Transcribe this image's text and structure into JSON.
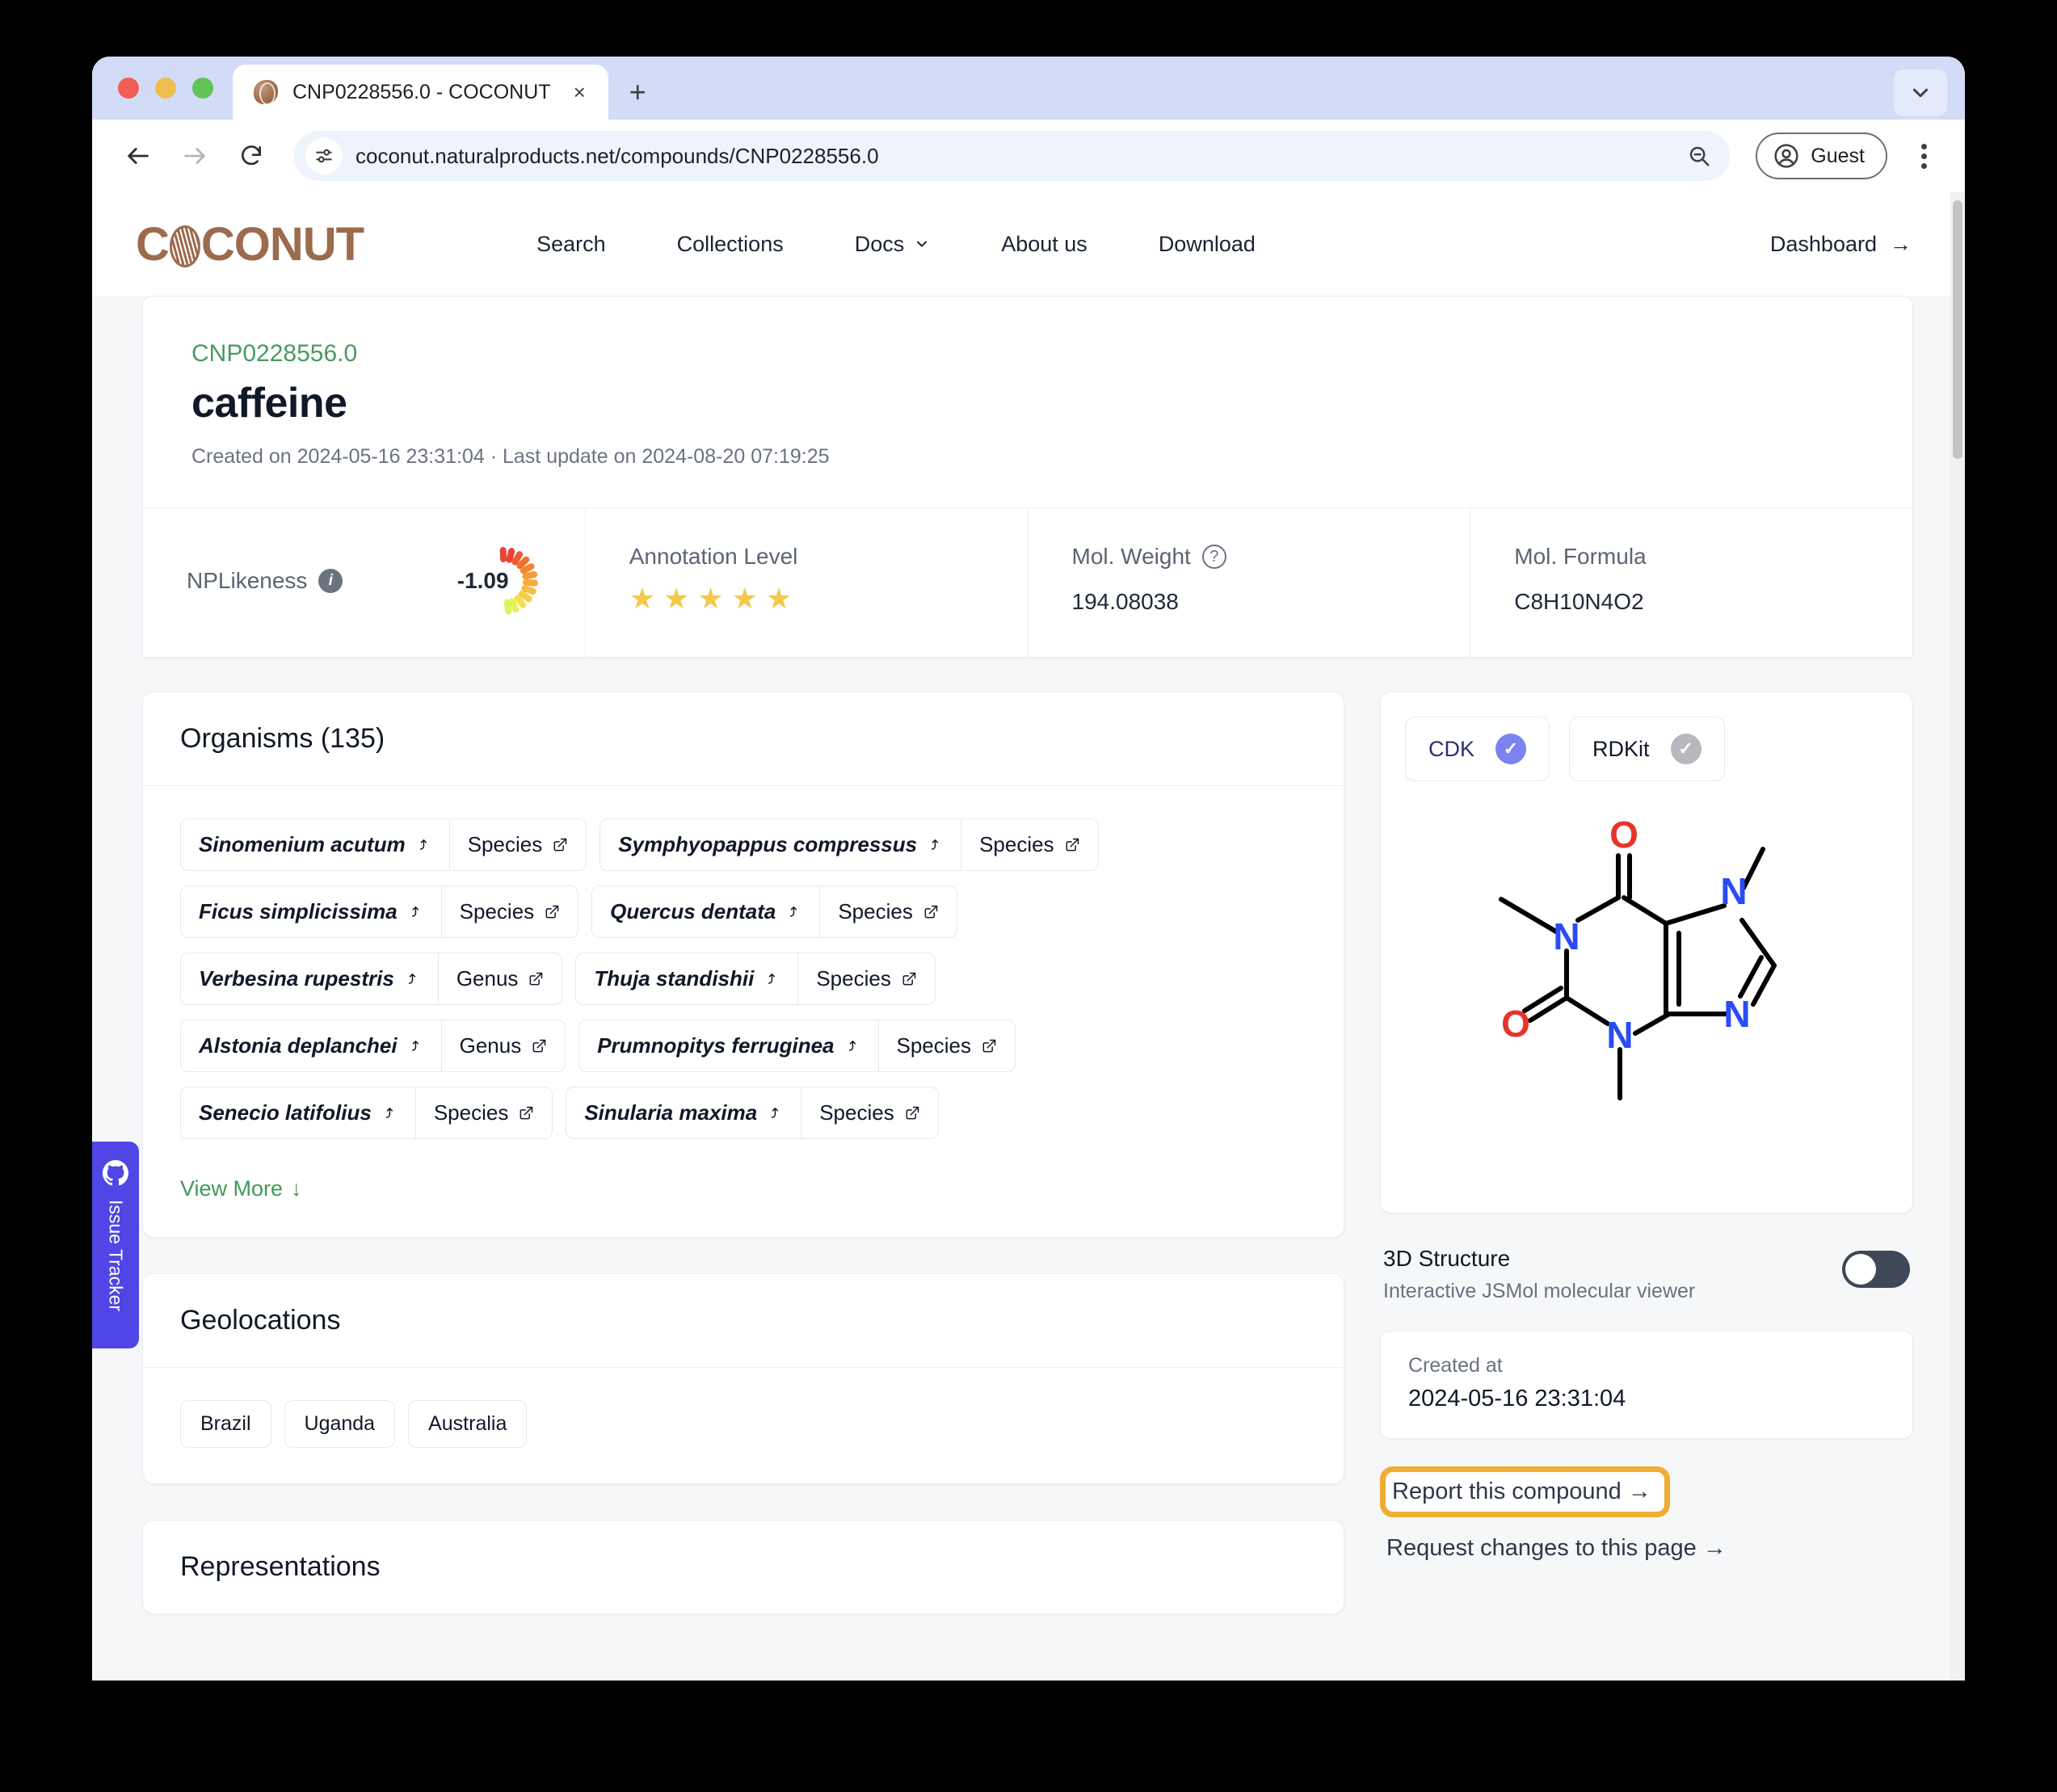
{
  "browser": {
    "tab": {
      "title": "CNP0228556.0 - COCONUT",
      "close_label": "×",
      "favicon": "coconut-favicon"
    },
    "new_tab_label": "+",
    "url": "coconut.naturalproducts.net/compounds/CNP0228556.0",
    "profile_label": "Guest",
    "back_icon": "back-arrow-icon",
    "forward_icon": "forward-arrow-icon",
    "reload_icon": "reload-icon",
    "site_info_icon": "site-settings-icon",
    "zoom_icon": "zoom-out-icon",
    "menu_icon": "kebab-menu-icon",
    "tab_list_icon": "chevron-down-icon"
  },
  "site": {
    "logo_text_left": "C",
    "logo_text_right": "CONUT",
    "nav": [
      {
        "label": "Search",
        "name": "nav-search"
      },
      {
        "label": "Collections",
        "name": "nav-collections"
      },
      {
        "label": "Docs",
        "name": "nav-docs",
        "caret": "⌄"
      },
      {
        "label": "About us",
        "name": "nav-about-us"
      },
      {
        "label": "Download",
        "name": "nav-download"
      }
    ],
    "dashboard": {
      "label": "Dashboard",
      "arrow": "→"
    }
  },
  "compound": {
    "id": "CNP0228556.0",
    "name": "caffeine",
    "meta": "Created on 2024-05-16 23:31:04 · Last update on 2024-08-20 07:19:25"
  },
  "stats": {
    "nplikeness": {
      "label": "NPLikeness",
      "value": "-1.09",
      "info_icon": "info-icon"
    },
    "annotation": {
      "label": "Annotation Level",
      "stars_filled": 5,
      "stars_total": 5,
      "star_glyph": "★"
    },
    "mol_weight": {
      "label": "Mol. Weight",
      "value": "194.08038",
      "help_icon": "question-mark-icon"
    },
    "mol_formula": {
      "label": "Mol. Formula",
      "value": "C8H10N4O2"
    }
  },
  "organisms": {
    "title": "Organisms (135)",
    "items": [
      {
        "name": "Sinomenium acutum",
        "rank": "Species"
      },
      {
        "name": "Symphyopappus compressus",
        "rank": "Species"
      },
      {
        "name": "Ficus simplicissima",
        "rank": "Species"
      },
      {
        "name": "Quercus dentata",
        "rank": "Species"
      },
      {
        "name": "Verbesina rupestris",
        "rank": "Genus"
      },
      {
        "name": "Thuja standishii",
        "rank": "Species"
      },
      {
        "name": "Alstonia deplanchei",
        "rank": "Genus"
      },
      {
        "name": "Prumnopitys ferruginea",
        "rank": "Species"
      },
      {
        "name": "Senecio latifolius",
        "rank": "Species"
      },
      {
        "name": "Sinularia maxima",
        "rank": "Species"
      }
    ],
    "view_more": "View More",
    "view_more_arrow": "↓"
  },
  "geolocations": {
    "title": "Geolocations",
    "items": [
      "Brazil",
      "Uganda",
      "Australia"
    ]
  },
  "representations": {
    "title": "Representations"
  },
  "structure": {
    "engines": [
      {
        "label": "CDK",
        "state": "active",
        "check": "✓"
      },
      {
        "label": "RDKit",
        "state": "inactive",
        "check": "✓"
      }
    ],
    "molecule": "caffeine-2d-structure",
    "atom_labels": [
      "O",
      "O",
      "N",
      "N",
      "N",
      "N"
    ]
  },
  "three_d": {
    "title": "3D Structure",
    "subtitle": "Interactive JSMol molecular viewer",
    "toggle_state": "off"
  },
  "created": {
    "label": "Created at",
    "value": "2024-05-16 23:31:04"
  },
  "actions": {
    "report": "Report this compound →",
    "request": "Request changes to this page →"
  },
  "issue_tracker": {
    "label": "Issue Tracker",
    "icon": "github-icon"
  },
  "colors": {
    "accent_green": "#4a9a5e",
    "brand_brown": "#9c6b4d",
    "highlight_orange": "#f0ad33",
    "indigo": "#4f46e5",
    "star_gold": "#f3c84c"
  }
}
